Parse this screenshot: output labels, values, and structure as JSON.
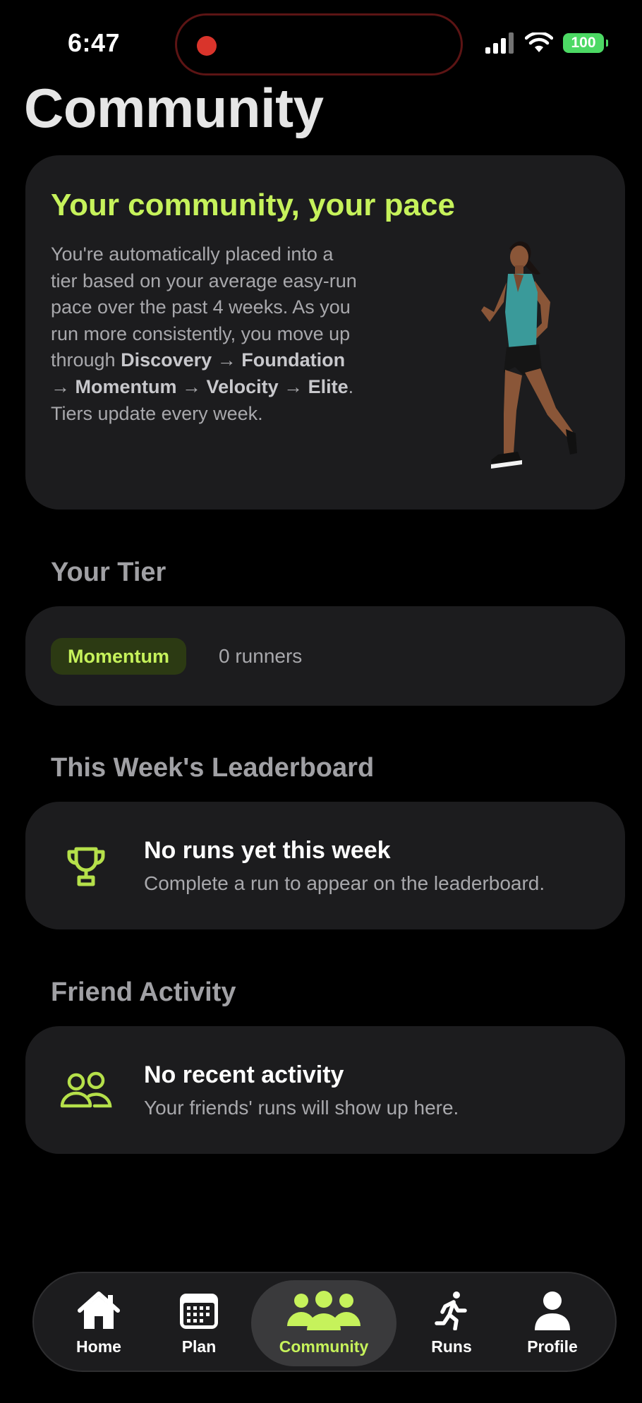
{
  "status_bar": {
    "time": "6:47",
    "battery": "100",
    "battery_color": "#4cd964",
    "icons": [
      "recording-indicator-icon",
      "cellular-signal-icon",
      "wifi-icon",
      "battery-icon"
    ]
  },
  "page": {
    "title": "Community"
  },
  "hero": {
    "title": "Your community, your pace",
    "body_parts": {
      "intro": "You're automatically placed into a tier based on your average easy-run pace over the past 4 weeks. As you run more consistently, you move up through ",
      "tier1": "Discovery",
      "tier2": "Foundation",
      "tier3": "Momentum",
      "tier4": "Velocity",
      "tier5": "Elite",
      "arrow": "→",
      "outro": ". Tiers update every week."
    },
    "image": "woman-running-photo"
  },
  "tier": {
    "section_title": "Your Tier",
    "badge": "Momentum",
    "runners": "0 runners"
  },
  "leaderboard": {
    "section_title": "This Week's Leaderboard",
    "icon": "trophy-icon",
    "empty_title": "No runs yet this week",
    "empty_subtitle": "Complete a run to appear on the leaderboard."
  },
  "friends": {
    "section_title": "Friend Activity",
    "icon": "people-icon",
    "empty_title": "No recent activity",
    "empty_subtitle": "Your friends' runs will show up here."
  },
  "tabbar": {
    "tabs": [
      {
        "label": "Home",
        "icon": "house-icon"
      },
      {
        "label": "Plan",
        "icon": "calendar-icon"
      },
      {
        "label": "Community",
        "icon": "group-icon",
        "active": true
      },
      {
        "label": "Runs",
        "icon": "running-figure-icon"
      },
      {
        "label": "Profile",
        "icon": "person-icon"
      }
    ]
  },
  "colors": {
    "accent": "#c6f25b",
    "background": "#000000",
    "card": "#1c1c1e",
    "badge_bg": "#2c3a13",
    "recording": "#d9342b"
  }
}
